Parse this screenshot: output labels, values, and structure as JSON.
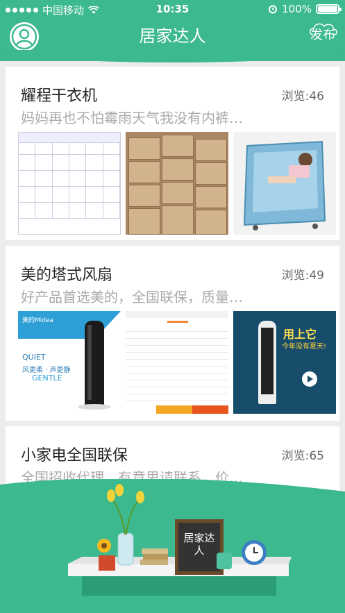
{
  "status": {
    "carrier": "中国移动",
    "time": "10:35",
    "battery": "100%"
  },
  "header": {
    "title": "居家达人",
    "publish": "发布"
  },
  "posts": [
    {
      "title": "耀程干衣机",
      "views": "浏览:46",
      "desc": "妈妈再也不怕霉雨天气我没有内裤…"
    },
    {
      "title": "美的塔式风扇",
      "views": "浏览:49",
      "desc": "好产品首选美的，全国联保，质量…"
    },
    {
      "title": "小家电全国联保",
      "views": "浏览:65",
      "desc": "全国招收代理，有意思请联系，价…"
    }
  ],
  "images": {
    "fan1_brand": "美的Midea",
    "fan1_quiet": "QUIET",
    "fan1_slogan": "风更柔 · 声更静",
    "fan1_gentle": "GENTLE",
    "fan3_title": "用上它",
    "fan3_sub": "今年没有夏天!"
  },
  "footer": {
    "board": "居家达人"
  },
  "colors": {
    "primary": "#3cb98f"
  }
}
